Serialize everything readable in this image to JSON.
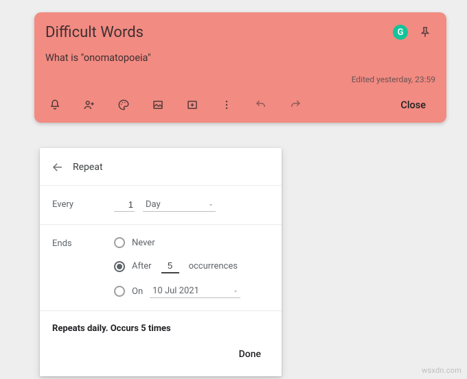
{
  "note": {
    "title": "Difficult Words",
    "body": "What is \"onomatopoeia\"",
    "edited": "Edited yesterday, 23:59",
    "g_badge": "G",
    "close_label": "Close"
  },
  "popup": {
    "title": "Repeat",
    "every_label": "Every",
    "every_value": "1",
    "every_unit": "Day",
    "ends_label": "Ends",
    "ends": {
      "never_label": "Never",
      "after_prefix": "After",
      "after_value": "5",
      "after_suffix": "occurrences",
      "on_label": "On",
      "on_date": "10 Jul 2021",
      "selected": "after"
    },
    "summary": "Repeats daily. Occurs 5 times",
    "done_label": "Done"
  },
  "watermark": "wsxdn.com"
}
